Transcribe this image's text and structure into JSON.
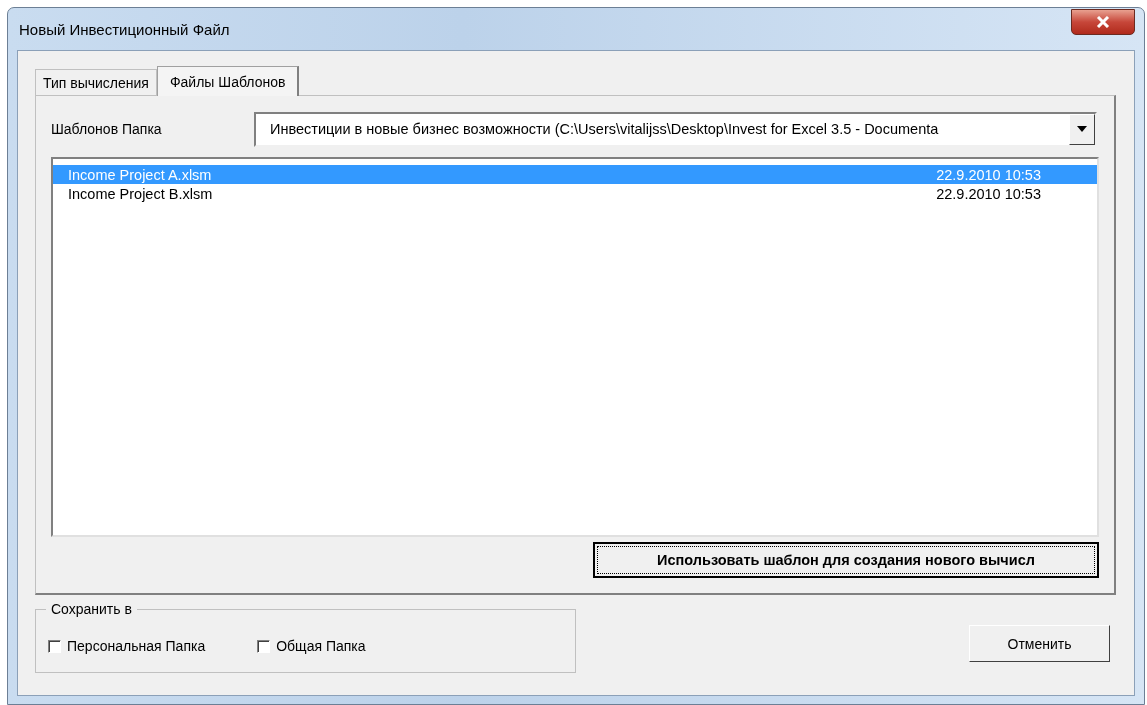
{
  "window": {
    "title": "Новый Инвестиционный Файл"
  },
  "tabs": [
    {
      "label": "Тип вычисления",
      "selected": false
    },
    {
      "label": "Файлы Шаблонов",
      "selected": true
    }
  ],
  "template_folder": {
    "label": "Шаблонов Папка",
    "value": "Инвестиции в новые бизнес возможности (C:\\Users\\vitalijss\\Desktop\\Invest for Excel 3.5 - Documenta"
  },
  "files": [
    {
      "name": "Income Project A.xlsm",
      "date": "22.9.2010 10:53",
      "selected": true
    },
    {
      "name": "Income Project B.xlsm",
      "date": "22.9.2010 10:53",
      "selected": false
    }
  ],
  "use_template_button": "Использовать шаблон для создания нового вычисл",
  "save_to": {
    "title": "Сохранить в",
    "options": [
      {
        "label": "Персональная Папка",
        "checked": false
      },
      {
        "label": "Общая Папка",
        "checked": false
      }
    ]
  },
  "cancel_button": "Отменить"
}
